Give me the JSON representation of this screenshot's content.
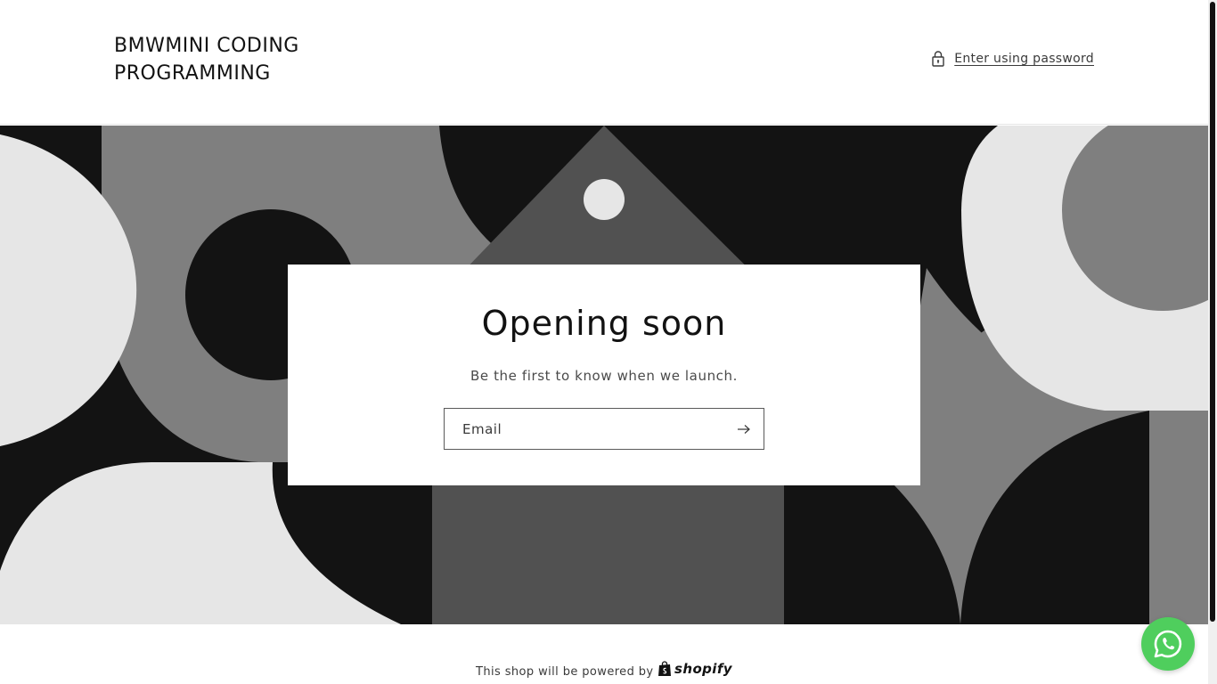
{
  "header": {
    "brand_line1": "BMWMINI CODING",
    "brand_line2": "PROGRAMMING",
    "password_link": "Enter using password"
  },
  "card": {
    "title": "Opening soon",
    "subtitle": "Be the first to know when we launch.",
    "email_placeholder": "Email"
  },
  "footer": {
    "powered_text": "This shop will be powered by",
    "shopify_label": "shopify"
  },
  "icons": {
    "lock": "lock-icon",
    "arrow": "arrow-right-icon",
    "shopify_bag": "shopify-bag-icon",
    "whatsapp": "whatsapp-icon"
  },
  "colors": {
    "hero_dark": "#131313",
    "hero_mid": "#7f7f7f",
    "hero_darkgray": "#515151",
    "hero_light": "#e6e6e6",
    "whatsapp_green": "#4fce5d"
  }
}
